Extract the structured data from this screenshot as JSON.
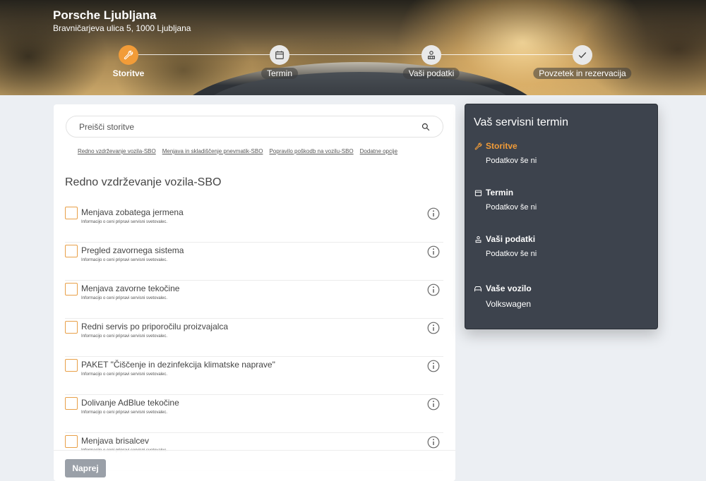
{
  "header": {
    "dealer_name": "Porsche Ljubljana",
    "dealer_address": "Bravničarjeva ulica 5, 1000 Ljubljana",
    "steps": [
      {
        "label": "Storitve",
        "icon": "wrench-icon",
        "active": true
      },
      {
        "label": "Termin",
        "icon": "calendar-icon",
        "active": false
      },
      {
        "label": "Vaši podatki",
        "icon": "person-icon",
        "active": false
      },
      {
        "label": "Povzetek in rezervacija",
        "icon": "check-icon",
        "active": false
      }
    ]
  },
  "search": {
    "placeholder": "Preišči storitve"
  },
  "category_links": [
    "Redno vzdrževanje vozila-SBO",
    "Menjava in skladiščenje pnevmatik-SBO",
    "Popravilo poškodb na vozilu-SBO",
    "Dodatne opcije"
  ],
  "section_title": "Redno vzdrževanje vozila-SBO",
  "services": [
    {
      "name": "Menjava zobatega jermena",
      "note": "Informacijo o ceni pripravi servisni svetovalec."
    },
    {
      "name": "Pregled zavornega sistema",
      "note": "Informacijo o ceni pripravi servisni svetovalec."
    },
    {
      "name": "Menjava zavorne tekočine",
      "note": "Informacijo o ceni pripravi servisni svetovalec."
    },
    {
      "name": "Redni servis po priporočilu proizvajalca",
      "note": "Informacijo o ceni pripravi servisni svetovalec."
    },
    {
      "name": "PAKET \"Čiščenje in dezinfekcija klimatske naprave\"",
      "note": "Informacijo o ceni pripravi servisni svetovalec."
    },
    {
      "name": "Dolivanje AdBlue tekočine",
      "note": "Informacijo o ceni pripravi servisni svetovalec."
    },
    {
      "name": "Menjava brisalcev",
      "note": "Informacijo o ceni pripravi servisni svetovalec."
    }
  ],
  "footer": {
    "next_label": "Naprej"
  },
  "summary": {
    "title": "Vaš servisni termin",
    "rows": [
      {
        "label": "Storitve",
        "value": "Podatkov še ni",
        "icon": "wrench-icon"
      },
      {
        "label": "Termin",
        "value": "Podatkov še ni",
        "icon": "calendar-icon"
      },
      {
        "label": "Vaši podatki",
        "value": "Podatkov še ni",
        "icon": "person-icon"
      },
      {
        "label": "Vaše vozilo",
        "value": "Volkswagen",
        "icon": "car-icon"
      }
    ]
  },
  "colors": {
    "accent": "#f29c38",
    "summary_bg": "#3d434d",
    "page_bg": "#eceff3",
    "button_disabled": "#9aa0a8"
  }
}
